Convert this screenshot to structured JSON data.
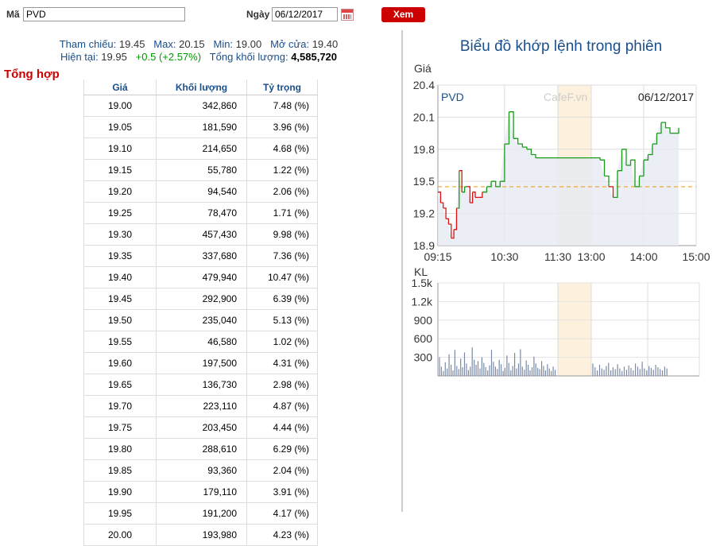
{
  "form": {
    "ma_label": "Mã",
    "ma_value": "PVD",
    "ngay_label": "Ngày",
    "ngay_value": "06/12/2017",
    "xem_label": "Xem"
  },
  "stats": {
    "tham_chieu_label": "Tham chiếu:",
    "tham_chieu": "19.45",
    "max_label": "Max:",
    "max": "20.15",
    "min_label": "Min:",
    "min": "19.00",
    "mo_cua_label": "Mở cửa:",
    "mo_cua": "19.40",
    "hien_tai_label": "Hiện tại:",
    "hien_tai": "19.95",
    "change": "+0.5 (+2.57%)",
    "tong_kl_label": "Tổng khối lượng:",
    "tong_kl": "4,585,720"
  },
  "summary_title": "Tổng hợp",
  "table": {
    "headers": [
      "Giá",
      "Khối lượng",
      "Tỷ trọng"
    ],
    "rows": [
      [
        "19.00",
        "342,860",
        "7.48 (%)"
      ],
      [
        "19.05",
        "181,590",
        "3.96 (%)"
      ],
      [
        "19.10",
        "214,650",
        "4.68 (%)"
      ],
      [
        "19.15",
        "55,780",
        "1.22 (%)"
      ],
      [
        "19.20",
        "94,540",
        "2.06 (%)"
      ],
      [
        "19.25",
        "78,470",
        "1.71 (%)"
      ],
      [
        "19.30",
        "457,430",
        "9.98 (%)"
      ],
      [
        "19.35",
        "337,680",
        "7.36 (%)"
      ],
      [
        "19.40",
        "479,940",
        "10.47 (%)"
      ],
      [
        "19.45",
        "292,900",
        "6.39 (%)"
      ],
      [
        "19.50",
        "235,040",
        "5.13 (%)"
      ],
      [
        "19.55",
        "46,580",
        "1.02 (%)"
      ],
      [
        "19.60",
        "197,500",
        "4.31 (%)"
      ],
      [
        "19.65",
        "136,730",
        "2.98 (%)"
      ],
      [
        "19.70",
        "223,110",
        "4.87 (%)"
      ],
      [
        "19.75",
        "203,450",
        "4.44 (%)"
      ],
      [
        "19.80",
        "288,610",
        "6.29 (%)"
      ],
      [
        "19.85",
        "93,360",
        "2.04 (%)"
      ],
      [
        "19.90",
        "179,110",
        "3.91 (%)"
      ],
      [
        "19.95",
        "191,200",
        "4.17 (%)"
      ],
      [
        "20.00",
        "193,980",
        "4.23 (%)"
      ]
    ]
  },
  "chart_title": "Biểu đồ khớp lệnh trong phiên",
  "chart_data": [
    {
      "type": "line",
      "ylabel": "Giá",
      "series_label": "PVD",
      "watermark": "CafeF.vn",
      "date": "06/12/2017",
      "ylim": [
        18.9,
        20.4
      ],
      "yticks": [
        "20.4",
        "20.1",
        "19.8",
        "19.5",
        "19.2",
        "18.9"
      ],
      "xticks": [
        "09:15",
        "10:30",
        "11:30",
        "13:00",
        "14:00",
        "15:00"
      ],
      "reference": 19.45,
      "x": [
        "09:15",
        "09:18",
        "09:21",
        "09:24",
        "09:27",
        "09:30",
        "09:33",
        "09:36",
        "09:39",
        "09:42",
        "09:45",
        "09:48",
        "09:51",
        "09:54",
        "09:57",
        "10:00",
        "10:05",
        "10:10",
        "10:15",
        "10:20",
        "10:25",
        "10:30",
        "10:35",
        "10:40",
        "10:45",
        "10:50",
        "10:55",
        "11:00",
        "11:05",
        "11:10",
        "11:15",
        "11:20",
        "11:25",
        "11:30",
        "13:00",
        "13:05",
        "13:10",
        "13:15",
        "13:20",
        "13:25",
        "13:30",
        "13:35",
        "13:40",
        "13:45",
        "13:50",
        "13:55",
        "14:00",
        "14:05",
        "14:10",
        "14:15",
        "14:20",
        "14:25",
        "14:30",
        "14:35",
        "14:40"
      ],
      "y": [
        19.4,
        19.3,
        19.25,
        19.15,
        19.1,
        18.97,
        19.05,
        19.25,
        19.6,
        19.4,
        19.45,
        19.45,
        19.3,
        19.4,
        19.35,
        19.35,
        19.4,
        19.45,
        19.5,
        19.45,
        19.5,
        19.85,
        20.15,
        19.9,
        19.85,
        19.82,
        19.8,
        19.75,
        19.72,
        19.72,
        19.72,
        19.72,
        19.72,
        19.72,
        19.72,
        19.72,
        19.7,
        19.55,
        19.45,
        19.35,
        19.6,
        19.8,
        19.65,
        19.7,
        19.45,
        19.55,
        19.7,
        19.75,
        19.85,
        19.95,
        20.05,
        20.0,
        19.95,
        19.95,
        20.0
      ]
    },
    {
      "type": "bar",
      "ylabel": "KL",
      "yticks": [
        "1.5k",
        "1.2k",
        "900",
        "600",
        "300"
      ],
      "ylim": [
        0,
        1500
      ],
      "values_morning": [
        300,
        150,
        80,
        220,
        120,
        350,
        180,
        90,
        420,
        160,
        110,
        280,
        140,
        380,
        200,
        95,
        150,
        460,
        260,
        180,
        240,
        120,
        300,
        210,
        140,
        90,
        170,
        420,
        230,
        150,
        110,
        260,
        190,
        80,
        130,
        330,
        210,
        90,
        160,
        370,
        120,
        200,
        430,
        150,
        100,
        250,
        180,
        90,
        140,
        310,
        200,
        130,
        110,
        240,
        160,
        90,
        190,
        120,
        80,
        150,
        100
      ],
      "values_afternoon": [
        200,
        140,
        90,
        180,
        120,
        100,
        160,
        210,
        90,
        140,
        110,
        190,
        120,
        80,
        150,
        100,
        170,
        130,
        90,
        200,
        150,
        110,
        230,
        120,
        90,
        160,
        130,
        100,
        180,
        140,
        110,
        90,
        150,
        120
      ]
    }
  ]
}
